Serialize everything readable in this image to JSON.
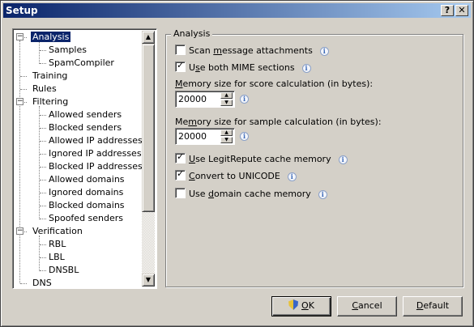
{
  "window": {
    "title": "Setup",
    "help_label": "?",
    "close_label": "✕"
  },
  "tree": {
    "items": [
      {
        "label": "Analysis",
        "expander": "−"
      },
      {
        "label": "Samples"
      },
      {
        "label": "SpamCompiler"
      },
      {
        "label": "Training"
      },
      {
        "label": "Rules"
      },
      {
        "label": "Filtering",
        "expander": "−"
      },
      {
        "label": "Allowed senders"
      },
      {
        "label": "Blocked senders"
      },
      {
        "label": "Allowed IP addresses"
      },
      {
        "label": "Ignored IP addresses"
      },
      {
        "label": "Blocked IP addresses"
      },
      {
        "label": "Allowed domains"
      },
      {
        "label": "Ignored domains"
      },
      {
        "label": "Blocked domains"
      },
      {
        "label": "Spoofed senders"
      },
      {
        "label": "Verification",
        "expander": "−"
      },
      {
        "label": "RBL"
      },
      {
        "label": "LBL"
      },
      {
        "label": "DNSBL"
      },
      {
        "label": "DNS"
      }
    ],
    "scroll_up_icon": "▲",
    "scroll_down_icon": "▼"
  },
  "analysis": {
    "group_title": "Analysis",
    "scan_attachments": {
      "pre": "Scan ",
      "u": "m",
      "post": "essage attachments",
      "checked": false
    },
    "use_mime": {
      "pre": "U",
      "u": "s",
      "post": "e both MIME sections",
      "checked": true
    },
    "score_label": {
      "pre": "",
      "u": "M",
      "post": "emory size for score calculation (in bytes):"
    },
    "score_value": "20000",
    "sample_label": {
      "pre": "Me",
      "u": "m",
      "post": "ory size for sample calculation (in bytes):"
    },
    "sample_value": "20000",
    "legitrepute": {
      "pre": "",
      "u": "U",
      "post": "se LegitRepute cache memory",
      "checked": true
    },
    "unicode": {
      "pre": "",
      "u": "C",
      "post": "onvert to UNICODE",
      "checked": true
    },
    "domain_cache": {
      "pre": "Use ",
      "u": "d",
      "post": "omain cache memory",
      "checked": false
    },
    "check_mark": "✓",
    "info_glyph": "i",
    "spin_up_icon": "▲",
    "spin_down_icon": "▼"
  },
  "buttons": {
    "ok": {
      "u": "O",
      "post": "K"
    },
    "cancel": {
      "pre": "",
      "u": "C",
      "post": "ancel"
    },
    "default": {
      "pre": "",
      "u": "D",
      "post": "efault"
    }
  }
}
